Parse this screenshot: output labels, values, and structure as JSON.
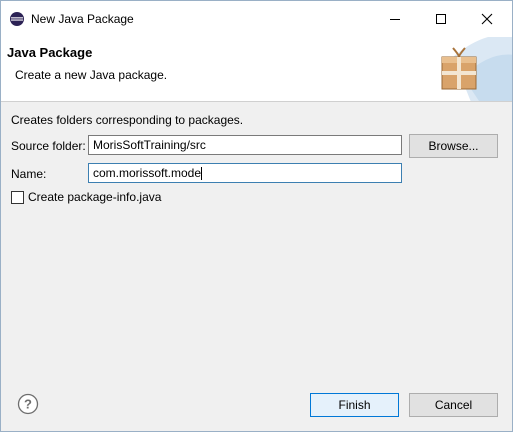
{
  "window": {
    "title": "New Java Package",
    "icon": "eclipse-icon"
  },
  "header": {
    "title": "Java Package",
    "description": "Create a new Java package.",
    "icon": "package-gift-icon"
  },
  "form": {
    "description": "Creates folders corresponding to packages.",
    "source_folder_label": "Source folder:",
    "source_folder_value": "MorisSoftTraining/src",
    "browse_label": "Browse...",
    "name_label": "Name:",
    "name_value": "com.morissoft.mode",
    "create_package_info_label": "Create package-info.java",
    "create_package_info_checked": false
  },
  "footer": {
    "help_icon": "help-icon",
    "finish_label": "Finish",
    "cancel_label": "Cancel"
  },
  "colors": {
    "accent": "#0078d7",
    "focused_border": "#3c7fb1",
    "button_bg": "#e1e1e1",
    "dialog_bg": "#f0f0f0"
  }
}
